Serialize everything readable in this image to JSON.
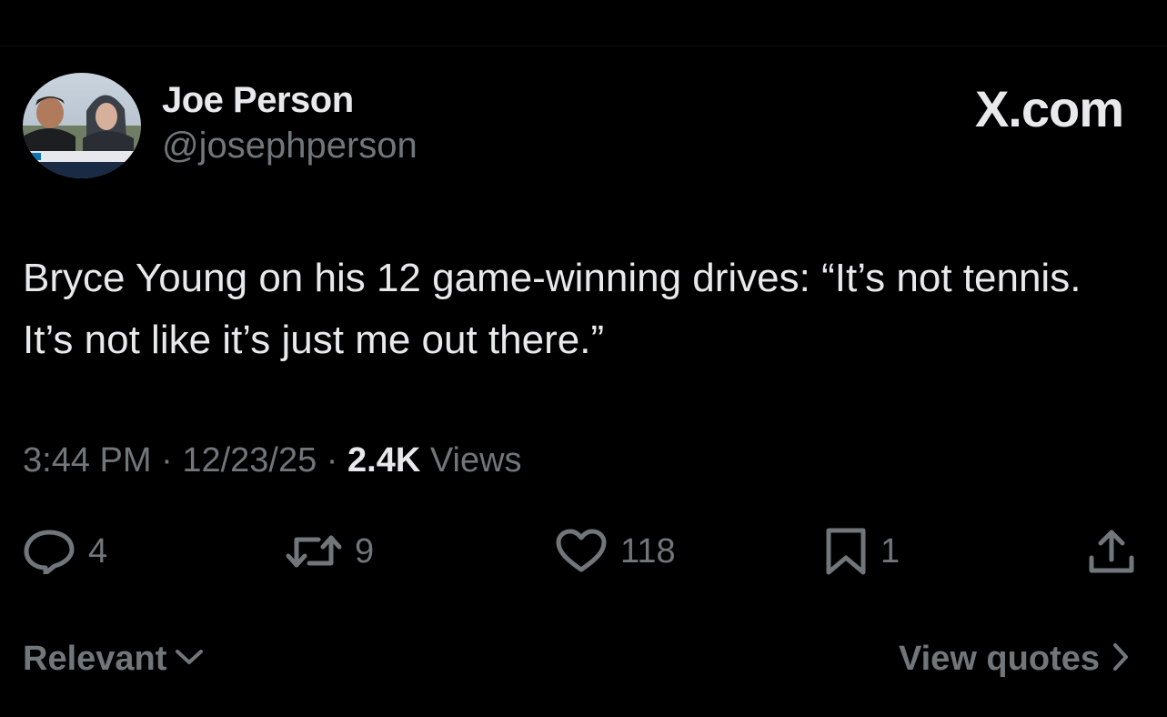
{
  "header": {
    "display_name": "Joe Person",
    "handle": "@josephperson",
    "brand": "X.com"
  },
  "tweet": {
    "text": "Bryce Young on his 12 game-winning drives: “It’s not tennis. It’s not like it’s just me out there.”",
    "time": "3:44 PM",
    "separator": "·",
    "date": "12/23/25",
    "views_count": "2.4K",
    "views_label": "Views"
  },
  "actions": {
    "replies": "4",
    "reposts": "9",
    "likes": "118",
    "bookmarks": "1"
  },
  "footer": {
    "sort_label": "Relevant",
    "view_quotes_label": "View quotes"
  },
  "icons": {
    "reply": "reply-icon",
    "repost": "repost-icon",
    "like": "heart-icon",
    "bookmark": "bookmark-icon",
    "share": "share-icon",
    "sort_chevron": "chevron-down-icon",
    "quotes_chevron": "chevron-right-icon"
  },
  "colors": {
    "background": "#000000",
    "primary_text": "#e7e9ea",
    "secondary_text": "#71767b"
  }
}
